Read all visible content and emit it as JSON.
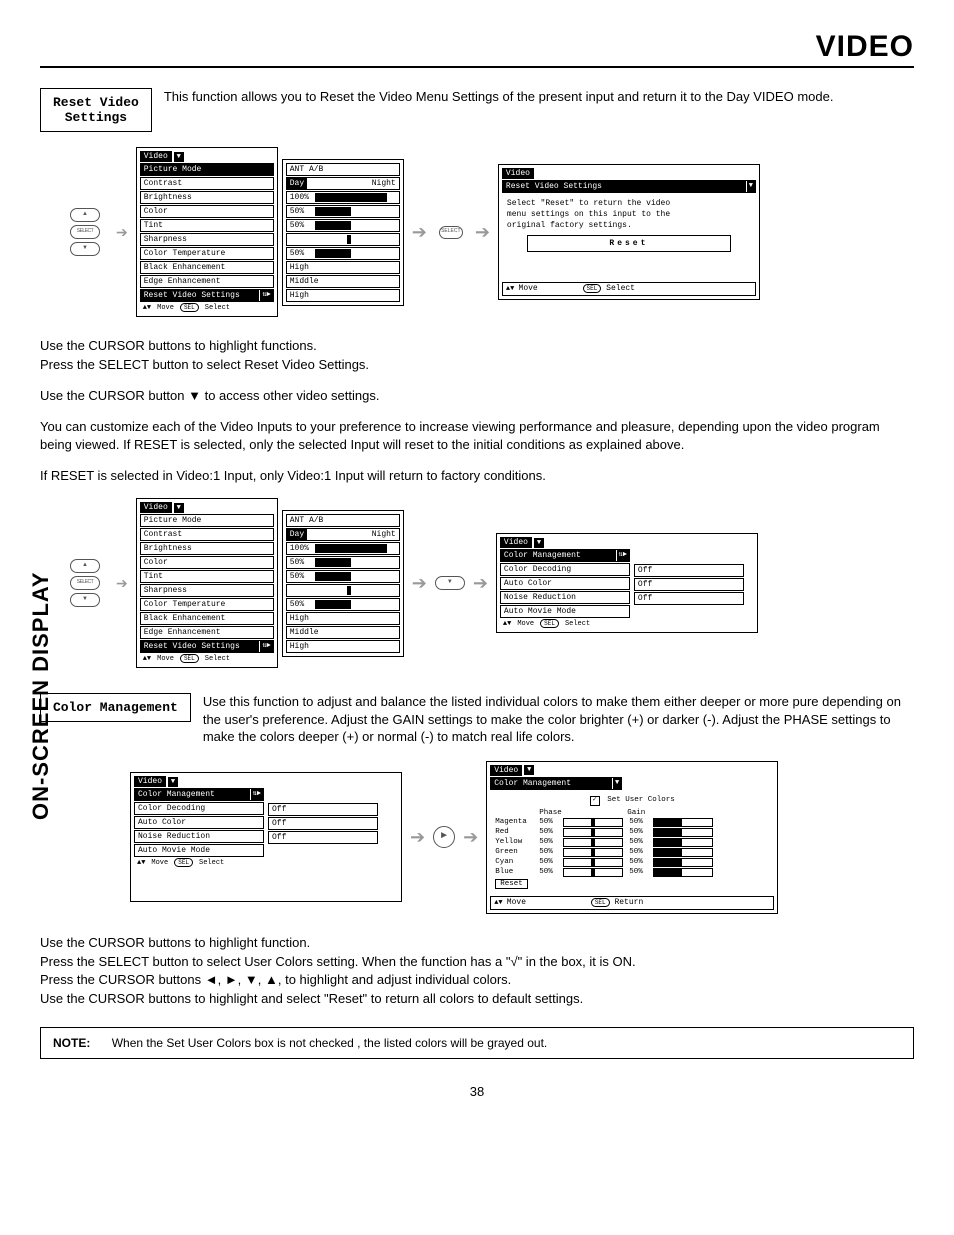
{
  "page": {
    "title": "VIDEO",
    "side_label": "ON-SCREEN DISPLAY",
    "page_number": "38"
  },
  "section1": {
    "label": "Reset Video\nSettings",
    "desc": "This function allows you to Reset the Video Menu Settings of the present input and return it to the Day VIDEO mode."
  },
  "osd_video": {
    "title": "Video",
    "items": [
      "Picture Mode",
      "Contrast",
      "Brightness",
      "Color",
      "Tint",
      "Sharpness",
      "Color Temperature",
      "Black Enhancement",
      "Edge Enhancement",
      "Reset Video Settings"
    ],
    "hint_move": "Move",
    "hint_select": "Select"
  },
  "osd_values": {
    "header": "ANT A/B",
    "picture_mode": {
      "left": "Day",
      "right": "Night"
    },
    "contrast": "100%",
    "brightness": "50%",
    "color": "50%",
    "sharpness": "50%",
    "color_temp": "High",
    "black_enh": "Middle",
    "edge_enh": "High"
  },
  "reset_panel": {
    "title": "Video",
    "subtitle": "Reset Video Settings",
    "text1": "Select \"Reset\" to return the video",
    "text2": "menu settings on this input to the",
    "text3": "original factory settings.",
    "button": "Reset",
    "hint_move": "Move",
    "hint_select": "Select"
  },
  "body1": {
    "p1": "Use the CURSOR buttons to highlight functions.",
    "p2": "Press the SELECT button to select Reset Video Settings.",
    "p3": "Use the CURSOR button ▼ to access other video settings.",
    "p4": "You can customize each of the Video Inputs to your preference to increase viewing performance and pleasure, depending upon the video program being viewed. If RESET is selected, only the selected Input will reset to the initial conditions as explained above.",
    "p5": "If RESET is selected in Video:1 Input, only Video:1 Input will return to factory conditions."
  },
  "cm_panel": {
    "title": "Video",
    "subtitle": "Color Management",
    "items": [
      "Color Decoding",
      "Auto Color",
      "Noise Reduction",
      "Auto Movie Mode"
    ],
    "val_off": "Off",
    "hint_move": "Move",
    "hint_select": "Select"
  },
  "section2": {
    "label": "Color Management",
    "desc": "Use this function to adjust and balance the listed individual colors to make them either deeper or more pure depending on the user's preference.  Adjust the GAIN settings to make the color brighter (+) or darker (-).  Adjust the PHASE settings to make the colors deeper (+) or normal (-) to match real life colors."
  },
  "color_detail": {
    "title": "Video",
    "subtitle": "Color Management",
    "checkbox": "Set User Colors",
    "col_phase": "Phase",
    "col_gain": "Gain",
    "rows": [
      {
        "name": "Magenta",
        "phase": "50%",
        "gain": "50%"
      },
      {
        "name": "Red",
        "phase": "50%",
        "gain": "50%"
      },
      {
        "name": "Yellow",
        "phase": "50%",
        "gain": "50%"
      },
      {
        "name": "Green",
        "phase": "50%",
        "gain": "50%"
      },
      {
        "name": "Cyan",
        "phase": "50%",
        "gain": "50%"
      },
      {
        "name": "Blue",
        "phase": "50%",
        "gain": "50%"
      }
    ],
    "reset": "Reset",
    "hint_move": "Move",
    "hint_return": "Return"
  },
  "body2": {
    "p1": "Use the CURSOR buttons to highlight function.",
    "p2": "Press the SELECT button to select User Colors setting.  When the function has a \"√\" in the box, it is ON.",
    "p3": "Press  the CURSOR buttons ◄, ►, ▼, ▲, to highlight and adjust individual colors.",
    "p4": "Use  the CURSOR buttons to highlight and select \"Reset\" to return all colors to default settings."
  },
  "note": {
    "label": "NOTE:",
    "text": "When the Set User Colors box is not checked , the listed colors will be grayed out."
  },
  "remote": {
    "up": "▲",
    "down": "▼",
    "select": "SELECT",
    "right": "►"
  }
}
